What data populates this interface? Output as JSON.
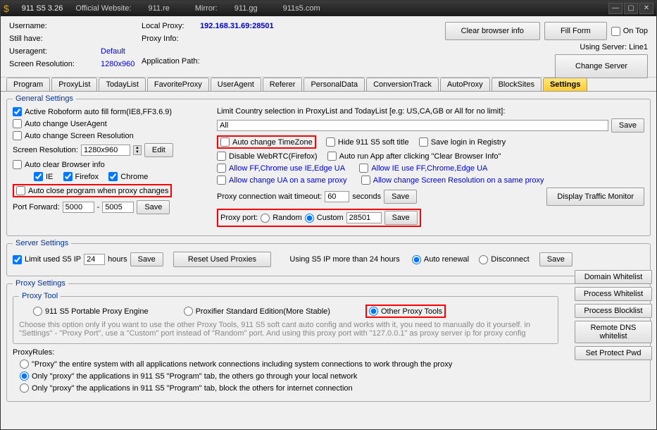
{
  "title": {
    "app": "911 S5 3.26",
    "website_label": "Official Website:",
    "website": "911.re",
    "mirror_label": "Mirror:",
    "mirror1": "911.gg",
    "mirror2": "911s5.com"
  },
  "info": {
    "username_label": "Username:",
    "stillhave_label": "Still have:",
    "useragent_label": "Useragent:",
    "useragent": "Default",
    "screenres_label": "Screen Resolution:",
    "screenres": "1280x960",
    "localproxy_label": "Local Proxy:",
    "localproxy": "192.168.31.69:28501",
    "proxyinfo_label": "Proxy Info:",
    "apppath_label": "Application Path:"
  },
  "topright": {
    "clear": "Clear browser info",
    "fill": "Fill Form",
    "ontop": "On Top",
    "using": "Using Server: Line1",
    "change": "Change Server"
  },
  "tabs": [
    "Program",
    "ProxyList",
    "TodayList",
    "FavoriteProxy",
    "UserAgent",
    "Referer",
    "PersonalData",
    "ConversionTrack",
    "AutoProxy",
    "BlockSites",
    "Settings"
  ],
  "gs": {
    "legend": "General Settings",
    "roboform": "Active Roboform auto fill form(IE8,FF3.6.9)",
    "auto_ua": "Auto change UserAgent",
    "auto_sr": "Auto change Screen Resolution",
    "sr_label": "Screen Resolution:",
    "sr_val": "1280x960",
    "edit": "Edit",
    "auto_clear": "Auto clear Browser info",
    "ie": "IE",
    "ff": "Firefox",
    "ch": "Chrome",
    "autoclose": "Auto close program when proxy changes",
    "pf_label": "Port Forward:",
    "pf1": "5000",
    "pf2": "5005",
    "save": "Save",
    "limit_label": "Limit Country selection in ProxyList and TodayList [e.g:  US,CA,GB  or All for no limit]:",
    "limit_val": "All",
    "auto_tz": "Auto change TimeZone",
    "hide_title": "Hide 911 S5 soft title",
    "save_reg": "Save login in Registry",
    "disable_webrtc": "Disable WebRTC(Firefox)",
    "autorun": "Auto run App after clicking \"Clear Browser Info\"",
    "allow_ff_ie": "Allow FF,Chrome use IE,Edge UA",
    "allow_ie_ff": "Allow IE use FF,Chrome,Edge UA",
    "allow_ua_same": "Allow change UA on a same proxy",
    "allow_sr_same": "Allow change Screen Resolution on a same proxy",
    "conn_timeout_label": "Proxy connection wait timeout:",
    "conn_timeout": "60",
    "seconds": "seconds",
    "proxyport_label": "Proxy port:",
    "random": "Random",
    "custom": "Custom",
    "port_val": "28501",
    "traffic": "Display Traffic Monitor"
  },
  "ss": {
    "legend": "Server Settings",
    "limit_ip": "Limit used S5 IP",
    "hours_val": "24",
    "hours": "hours",
    "save": "Save",
    "reset": "Reset Used Proxies",
    "using_more": "Using S5 IP more than 24 hours",
    "auto_renewal": "Auto renewal",
    "disconnect": "Disconnect"
  },
  "ps": {
    "legend": "Proxy Settings",
    "tool_legend": "Proxy Tool",
    "opt1": "911 S5 Portable Proxy Engine",
    "opt2": "Proxifier Standard Edition(More Stable)",
    "opt3": "Other Proxy Tools",
    "note": "Choose this option only if you want to use the other Proxy Tools, 911 S5 soft cant auto config and works with it, you need to manually do it yourself. in \"Settings\" - \"Proxy Port\", use a \"Custom\" port instead of \"Random\" port. And using this proxy port with \"127.0.0.1\" as proxy server ip for proxy config"
  },
  "pr": {
    "legend": "ProxyRules:",
    "r1": "\"Proxy\" the entire system with all applications network connections including system connections to work through the proxy",
    "r2": "Only \"proxy\" the applications in 911 S5 \"Program\" tab, the others go through your local network",
    "r3": "Only \"proxy\" the applications in 911 S5 \"Program\" tab, block the others for internet connection"
  },
  "side": {
    "domain_wl": "Domain Whitelist",
    "process_wl": "Process Whitelist",
    "process_bl": "Process Blocklist",
    "remote_dns": "Remote DNS whitelist",
    "protect": "Set Protect Pwd"
  }
}
